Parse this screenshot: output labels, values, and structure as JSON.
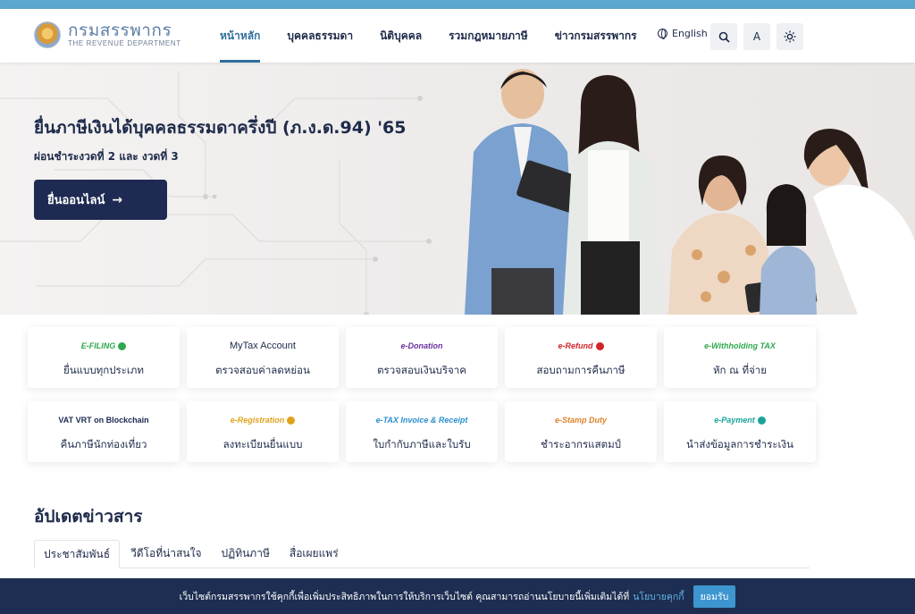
{
  "header": {
    "logo_th": "กรมสรรพากร",
    "logo_en": "THE REVENUE DEPARTMENT",
    "nav": [
      {
        "label": "หน้าหลัก",
        "active": true
      },
      {
        "label": "บุคคลธรรมดา",
        "active": false
      },
      {
        "label": "นิติบุคคล",
        "active": false
      },
      {
        "label": "รวมกฎหมายภาษี",
        "active": false
      },
      {
        "label": "ข่าวกรมสรรพากร",
        "active": false
      }
    ],
    "language_label": "English",
    "font_size_label": "A",
    "search_icon": "search-icon",
    "theme_icon": "sun-icon"
  },
  "hero": {
    "title": "ยื่นภาษีเงินได้บุคคลธรรมดาครึ่งปี (ภ.ง.ด.94) '65",
    "subtitle": "ผ่อนชำระงวดที่ 2 และ งวดที่ 3",
    "cta_label": "ยื่นออนไลน์",
    "cta_icon": "arrow-right-icon"
  },
  "services": [
    {
      "logo": "E-FILING",
      "label": "ยื่นแบบทุกประเภท",
      "accent": "#2fa84f"
    },
    {
      "logo": "MyTax Account",
      "label": "ตรวจสอบค่าลดหย่อน",
      "accent": "#1e2a4a"
    },
    {
      "logo": "e-Donation",
      "label": "ตรวจสอบเงินบริจาค",
      "accent": "#6a2fa0"
    },
    {
      "logo": "e-Refund",
      "label": "สอบถามการคืนภาษี",
      "accent": "#d2232a"
    },
    {
      "logo": "e-Withholding TAX",
      "label": "หัก ณ ที่จ่าย",
      "accent": "#2fa84f"
    },
    {
      "logo": "VAT VRT on Blockchain",
      "label": "คืนภาษีนักท่องเที่ยว",
      "accent": "#1e2a52"
    },
    {
      "logo": "e-Registration",
      "label": "ลงทะเบียนยื่นแบบ",
      "accent": "#e0a21b"
    },
    {
      "logo": "e-TAX Invoice & Receipt",
      "label": "ใบกำกับภาษีและใบรับ",
      "accent": "#2a8fd0"
    },
    {
      "logo": "e-Stamp Duty",
      "label": "ชำระอากรแสตมป์",
      "accent": "#e0822a"
    },
    {
      "logo": "e-Payment",
      "label": "นำส่งข้อมูลการชำระเงิน",
      "accent": "#1aa39a"
    }
  ],
  "news": {
    "title": "อัปเดตข่าวสาร",
    "tabs": [
      {
        "label": "ประชาสัมพันธ์",
        "active": true
      },
      {
        "label": "วีดีโอที่น่าสนใจ",
        "active": false
      },
      {
        "label": "ปฏิทินภาษี",
        "active": false
      },
      {
        "label": "สื่อเผยแพร่",
        "active": false
      }
    ]
  },
  "cookie": {
    "text": "เว็บไซต์กรมสรรพากรใช้คุกกี้เพื่อเพิ่มประสิทธิภาพในการให้บริการเว็บไซต์ คุณสามารถอ่านนโยบายนี้เพิ่มเติมได้ที่",
    "link": "นโยบายคุกกี้",
    "accept": "ยอมรับ"
  },
  "colors": {
    "top_strip": "#5aa7cf",
    "navy": "#1e2a52",
    "active_nav": "#2e6e9e",
    "cookie_bar": "#1e2e52",
    "accept_button": "#3d96cf"
  }
}
